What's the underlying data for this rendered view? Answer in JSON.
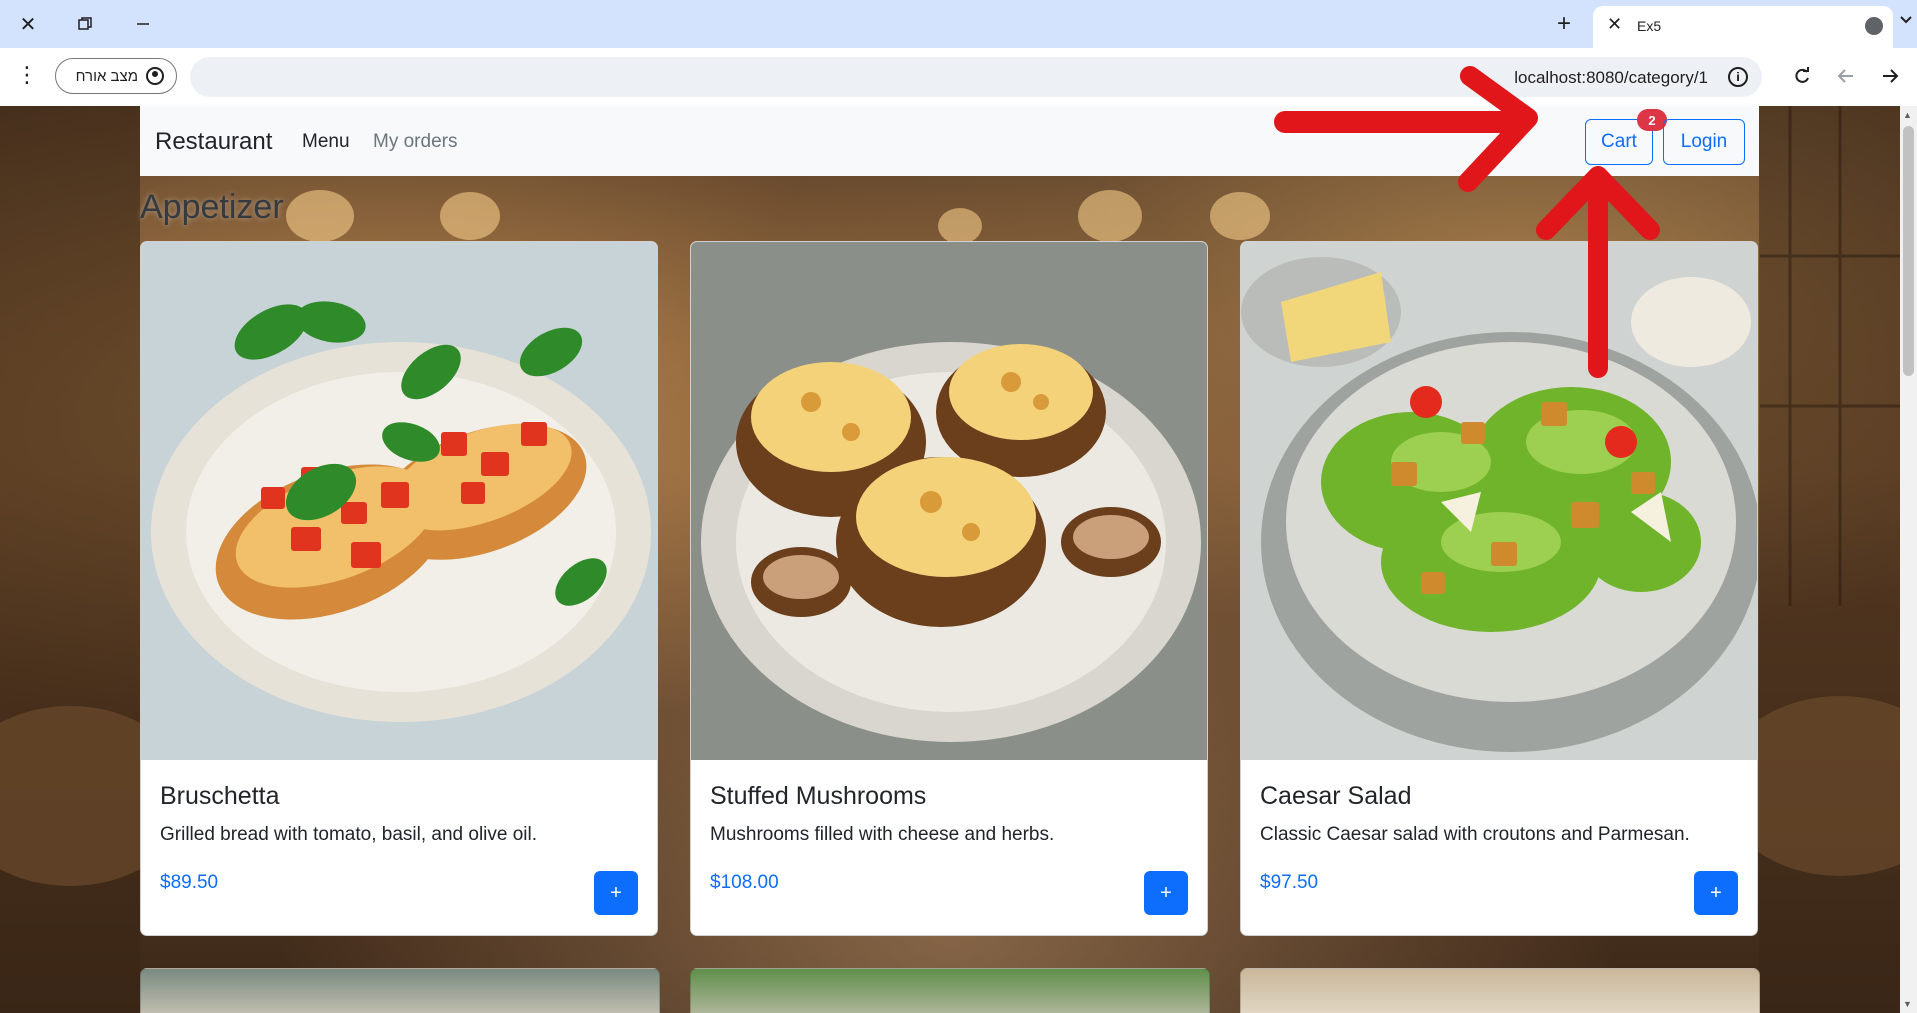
{
  "browser": {
    "tab_title": "Ex5",
    "tab_close": "✕",
    "new_tab": "+",
    "profile_label": "מצב אורח",
    "url": "localhost:8080/category/1",
    "window_controls": [
      "close-icon",
      "restore-icon",
      "minimize-icon"
    ]
  },
  "navbar": {
    "brand": "Restaurant",
    "menu_link": "Menu",
    "orders_link": "My orders",
    "cart_label": "Cart",
    "cart_badge": "2",
    "login_label": "Login"
  },
  "category": {
    "title": "Appetizer"
  },
  "items": [
    {
      "name": "Bruschetta",
      "description": "Grilled bread with tomato, basil, and olive oil.",
      "price": "$89.50",
      "add_label": "+"
    },
    {
      "name": "Stuffed Mushrooms",
      "description": "Mushrooms filled with cheese and herbs.",
      "price": "$108.00",
      "add_label": "+"
    },
    {
      "name": "Caesar Salad",
      "description": "Classic Caesar salad with croutons and Parmesan.",
      "price": "$97.50",
      "add_label": "+"
    }
  ],
  "colors": {
    "primary": "#0d6efd",
    "badge": "#dc3545",
    "navbar_bg": "#f8f9fa",
    "annotation_arrow": "#e0161a"
  }
}
